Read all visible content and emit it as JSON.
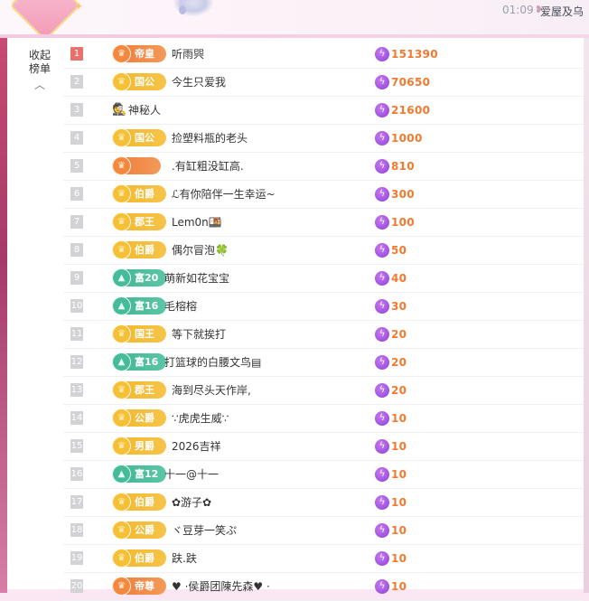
{
  "header": {
    "time": "01:09",
    "room_name": "爱屋及乌"
  },
  "panel": {
    "collapse_label_top": "收起",
    "collapse_label_bottom": "榜单",
    "collapse_icon": "chevron-up-icon"
  },
  "colors": {
    "score": "#f2792f",
    "gold_badge": "#f2b72a",
    "orange_badge": "#ef7a3a",
    "teal_badge": "#3fb493",
    "rank_first": "#e9706b"
  },
  "leaderboard": [
    {
      "rank": "1",
      "badge": "帝皇",
      "badge_style": "orange",
      "name": "听雨巺",
      "score": "151390"
    },
    {
      "rank": "2",
      "badge": "国公",
      "badge_style": "gold",
      "name": "今生只爱我",
      "score": "70650"
    },
    {
      "rank": "3",
      "badge": "",
      "badge_style": "mystery",
      "name": "神秘人",
      "score": "21600"
    },
    {
      "rank": "4",
      "badge": "国公",
      "badge_style": "gold",
      "name": "捡塑料瓶的老头",
      "score": "1000"
    },
    {
      "rank": "5",
      "badge": "",
      "badge_style": "orange",
      "name": ".有缸粗没缸高.",
      "score": "810"
    },
    {
      "rank": "6",
      "badge": "伯爵",
      "badge_style": "gold",
      "name": "ℒ有你陪伴一生幸运~",
      "score": "300"
    },
    {
      "rank": "7",
      "badge": "郡王",
      "badge_style": "gold",
      "name": "Lem0n🍱",
      "score": "100"
    },
    {
      "rank": "8",
      "badge": "伯爵",
      "badge_style": "gold",
      "name": "偶尔冒泡🍀",
      "score": "50"
    },
    {
      "rank": "9",
      "badge": "富20",
      "badge_style": "teal",
      "name": "萌新如花宝宝",
      "score": "40"
    },
    {
      "rank": "10",
      "badge": "富16",
      "badge_style": "teal",
      "name": "毛榕榕",
      "score": "30"
    },
    {
      "rank": "11",
      "badge": "国王",
      "badge_style": "gold",
      "name": "等下就挨打",
      "score": "20"
    },
    {
      "rank": "12",
      "badge": "富16",
      "badge_style": "teal",
      "name": "打篮球的白腰文鸟▤",
      "score": "20"
    },
    {
      "rank": "13",
      "badge": "郡王",
      "badge_style": "gold",
      "name": "海到尽头天作岸,",
      "score": "20"
    },
    {
      "rank": "14",
      "badge": "公爵",
      "badge_style": "gold",
      "name": "∵虎虎生威∵",
      "score": "10"
    },
    {
      "rank": "15",
      "badge": "男爵",
      "badge_style": "gold",
      "name": "2026吉祥",
      "score": "10"
    },
    {
      "rank": "16",
      "badge": "富12",
      "badge_style": "teal",
      "name": "十一@十一",
      "score": "10"
    },
    {
      "rank": "17",
      "badge": "伯爵",
      "badge_style": "gold",
      "name": "✿游子✿",
      "score": "10"
    },
    {
      "rank": "18",
      "badge": "公爵",
      "badge_style": "gold",
      "name": "ヾ豆芽一笑ぷ",
      "score": "10"
    },
    {
      "rank": "19",
      "badge": "伯爵",
      "badge_style": "gold",
      "name": "趺.趺",
      "score": "10"
    },
    {
      "rank": "20",
      "badge": "帝尊",
      "badge_style": "orange",
      "name": "♥ ·侯爵团陳先森♥ ·",
      "score": "10"
    }
  ]
}
